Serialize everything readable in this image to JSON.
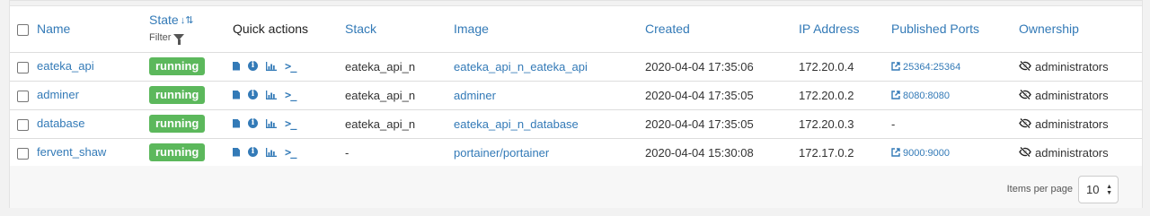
{
  "columns": {
    "name": "Name",
    "state": "State",
    "state_filter": "Filter",
    "quick_actions": "Quick actions",
    "stack": "Stack",
    "image": "Image",
    "created": "Created",
    "ip": "IP Address",
    "ports": "Published Ports",
    "ownership": "Ownership"
  },
  "rows": [
    {
      "name": "eateka_api",
      "state": "running",
      "stack": "eateka_api_n",
      "image": "eateka_api_n_eateka_api",
      "created": "2020-04-04 17:35:06",
      "ip": "172.20.0.4",
      "port": "25364:25364",
      "ownership": "administrators"
    },
    {
      "name": "adminer",
      "state": "running",
      "stack": "eateka_api_n",
      "image": "adminer",
      "created": "2020-04-04 17:35:05",
      "ip": "172.20.0.2",
      "port": "8080:8080",
      "ownership": "administrators"
    },
    {
      "name": "database",
      "state": "running",
      "stack": "eateka_api_n",
      "image": "eateka_api_n_database",
      "created": "2020-04-04 17:35:05",
      "ip": "172.20.0.3",
      "port": "-",
      "ownership": "administrators"
    },
    {
      "name": "fervent_shaw",
      "state": "running",
      "stack": "-",
      "image": "portainer/portainer",
      "created": "2020-04-04 15:30:08",
      "ip": "172.17.0.2",
      "port": "9000:9000",
      "ownership": "administrators"
    }
  ],
  "footer": {
    "items_per_page_label": "Items per page",
    "items_per_page_value": "10"
  },
  "icons": {
    "logs": "file-icon",
    "inspect": "info-icon",
    "stats": "chart-icon",
    "console": "terminal-icon",
    "port_link": "external-link-icon",
    "ownership": "eye-slash-icon",
    "sort": "sort-icon",
    "filter": "filter-icon"
  },
  "colors": {
    "link": "#337ab7",
    "running_badge": "#5cb85c"
  }
}
